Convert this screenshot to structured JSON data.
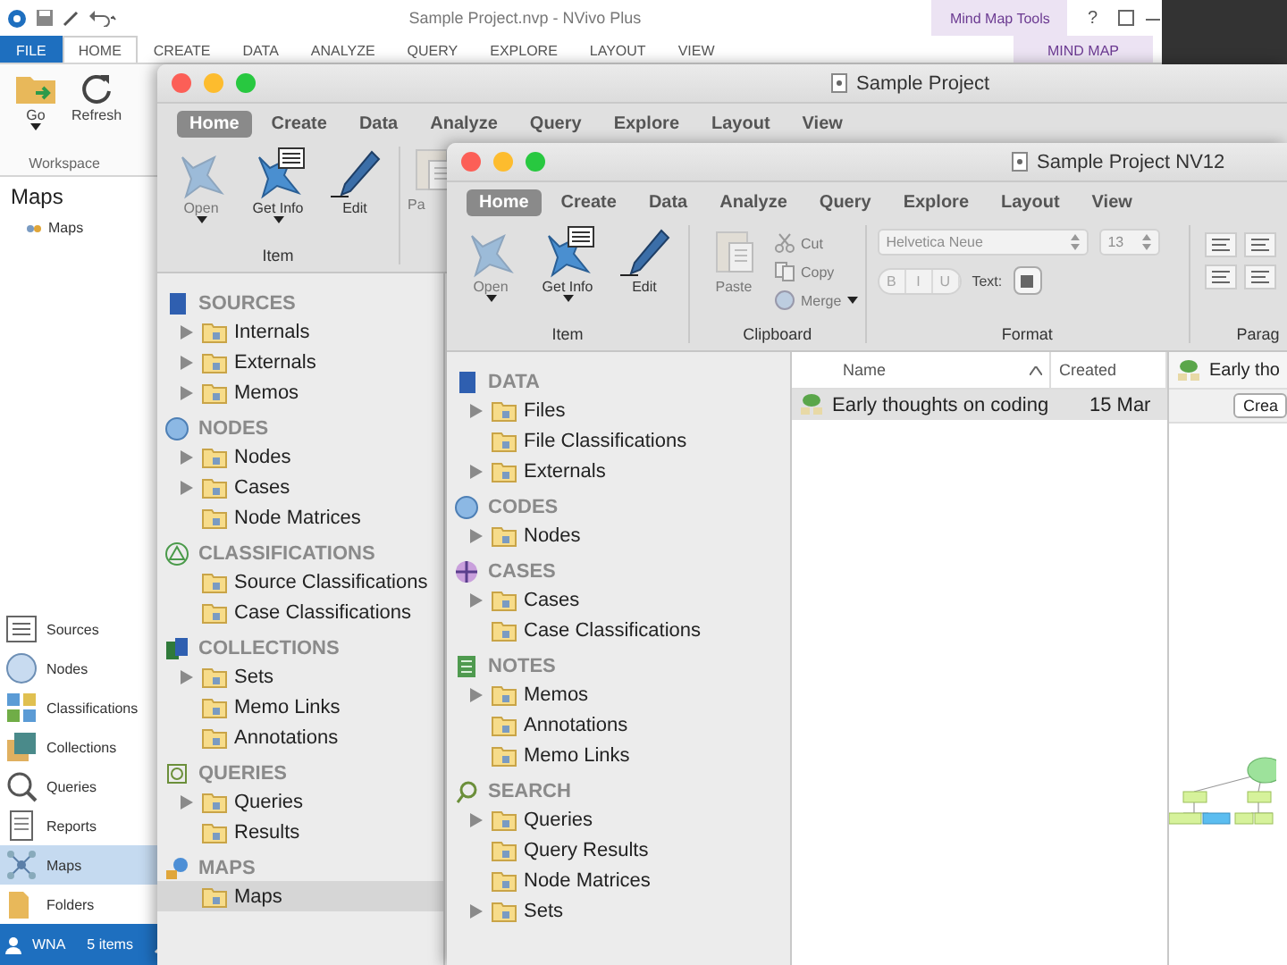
{
  "back_window": {
    "title": "Sample Project.nvp - NVivo Plus",
    "tool_group": "Mind Map Tools",
    "help": "?",
    "tabs": [
      {
        "label": "FILE",
        "kind": "file",
        "selected": false
      },
      {
        "label": "HOME",
        "kind": "main",
        "selected": true
      },
      {
        "label": "CREATE",
        "kind": "main",
        "selected": false
      },
      {
        "label": "DATA",
        "kind": "main",
        "selected": false
      },
      {
        "label": "ANALYZE",
        "kind": "main",
        "selected": false
      },
      {
        "label": "QUERY",
        "kind": "main",
        "selected": false
      },
      {
        "label": "EXPLORE",
        "kind": "main",
        "selected": false
      },
      {
        "label": "LAYOUT",
        "kind": "main",
        "selected": false
      },
      {
        "label": "VIEW",
        "kind": "main",
        "selected": false
      },
      {
        "label": "MIND MAP",
        "kind": "tool",
        "selected": false
      }
    ],
    "ribbon": {
      "group": "Workspace",
      "buttons": [
        {
          "label": "Go",
          "kind": "go",
          "dropdown": true
        },
        {
          "label": "Refresh",
          "kind": "refresh",
          "dropdown": false
        }
      ]
    },
    "navigation_title": "Maps",
    "tree": [
      {
        "label": "Maps",
        "selected": false
      }
    ],
    "nav_buttons": [
      {
        "label": "Sources",
        "kind": "sources",
        "selected": false
      },
      {
        "label": "Nodes",
        "kind": "nodes",
        "selected": false
      },
      {
        "label": "Classifications",
        "kind": "classifications",
        "selected": false
      },
      {
        "label": "Collections",
        "kind": "collections",
        "selected": false
      },
      {
        "label": "Queries",
        "kind": "queries",
        "selected": false
      },
      {
        "label": "Reports",
        "kind": "reports",
        "selected": false
      },
      {
        "label": "Maps",
        "kind": "maps",
        "selected": true
      },
      {
        "label": "Folders",
        "kind": "folders",
        "selected": false
      }
    ],
    "status_bar": {
      "user": "WNA",
      "items": "5 items"
    }
  },
  "middle_window": {
    "title": "Sample Project",
    "tabs": [
      {
        "label": "Home",
        "selected": true
      },
      {
        "label": "Create",
        "selected": false
      },
      {
        "label": "Data",
        "selected": false
      },
      {
        "label": "Analyze",
        "selected": false
      },
      {
        "label": "Query",
        "selected": false
      },
      {
        "label": "Explore",
        "selected": false
      },
      {
        "label": "Layout",
        "selected": false
      },
      {
        "label": "View",
        "selected": false
      }
    ],
    "ribbon": {
      "group": "Item",
      "buttons": [
        {
          "label": "Open",
          "kind": "node",
          "disabled": true,
          "dropdown": true
        },
        {
          "label": "Get Info",
          "kind": "info",
          "disabled": false,
          "dropdown": true
        },
        {
          "label": "Edit",
          "kind": "pencil",
          "disabled": false,
          "dropdown": false
        }
      ],
      "partial_button": {
        "label": "Pa",
        "kind": "paste",
        "disabled": true
      }
    },
    "sidebar": [
      {
        "heading": "SOURCES",
        "kind": "book",
        "items": [
          {
            "label": "Internals",
            "expandable": true,
            "selected": false
          },
          {
            "label": "Externals",
            "expandable": true,
            "selected": false
          },
          {
            "label": "Memos",
            "expandable": true,
            "selected": false
          }
        ]
      },
      {
        "heading": "NODES",
        "kind": "sphere",
        "items": [
          {
            "label": "Nodes",
            "expandable": true,
            "selected": false
          },
          {
            "label": "Cases",
            "expandable": true,
            "selected": false
          },
          {
            "label": "Node Matrices",
            "expandable": false,
            "selected": false
          }
        ]
      },
      {
        "heading": "CLASSIFICATIONS",
        "kind": "triangle",
        "items": [
          {
            "label": "Source Classifications",
            "expandable": false,
            "selected": false
          },
          {
            "label": "Case Classifications",
            "expandable": false,
            "selected": false
          }
        ]
      },
      {
        "heading": "COLLECTIONS",
        "kind": "stack",
        "items": [
          {
            "label": "Sets",
            "expandable": true,
            "selected": false
          },
          {
            "label": "Memo Links",
            "expandable": false,
            "selected": false
          },
          {
            "label": "Annotations",
            "expandable": false,
            "selected": false
          }
        ]
      },
      {
        "heading": "QUERIES",
        "kind": "query",
        "items": [
          {
            "label": "Queries",
            "expandable": true,
            "selected": false
          },
          {
            "label": "Results",
            "expandable": false,
            "selected": false
          }
        ]
      },
      {
        "heading": "MAPS",
        "kind": "map",
        "items": [
          {
            "label": "Maps",
            "expandable": false,
            "selected": true
          }
        ]
      }
    ]
  },
  "front_window": {
    "title": "Sample Project NV12",
    "tabs": [
      {
        "label": "Home",
        "selected": true
      },
      {
        "label": "Create",
        "selected": false
      },
      {
        "label": "Data",
        "selected": false
      },
      {
        "label": "Analyze",
        "selected": false
      },
      {
        "label": "Query",
        "selected": false
      },
      {
        "label": "Explore",
        "selected": false
      },
      {
        "label": "Layout",
        "selected": false
      },
      {
        "label": "View",
        "selected": false
      }
    ],
    "ribbon": [
      {
        "kind": "buttons",
        "label": "Item",
        "buttons": [
          {
            "label": "Open",
            "kind": "node",
            "disabled": true,
            "dropdown": true
          },
          {
            "label": "Get Info",
            "kind": "info",
            "disabled": false,
            "dropdown": true
          },
          {
            "label": "Edit",
            "kind": "pencil",
            "disabled": false,
            "dropdown": false
          }
        ]
      },
      {
        "kind": "clipboard",
        "label": "Clipboard",
        "paste": {
          "label": "Paste",
          "disabled": true
        },
        "small": [
          {
            "label": "Cut",
            "kind": "cut",
            "disabled": true,
            "dropdown": false
          },
          {
            "label": "Copy",
            "kind": "copy",
            "disabled": true,
            "dropdown": false
          },
          {
            "label": "Merge",
            "kind": "merge",
            "disabled": true,
            "dropdown": true
          }
        ]
      },
      {
        "kind": "format",
        "label": "Format",
        "font": "Helvetica Neue",
        "size": "13",
        "styles": [
          "B",
          "I",
          "U"
        ],
        "text_label": "Text:",
        "disabled": true
      },
      {
        "kind": "paragraph",
        "label": "Parag"
      }
    ],
    "sidebar": [
      {
        "heading": "DATA",
        "kind": "book",
        "items": [
          {
            "label": "Files",
            "expandable": true,
            "selected": false
          },
          {
            "label": "File Classifications",
            "expandable": false,
            "selected": false
          },
          {
            "label": "Externals",
            "expandable": true,
            "selected": false
          }
        ]
      },
      {
        "heading": "CODES",
        "kind": "sphere",
        "items": [
          {
            "label": "Nodes",
            "expandable": true,
            "selected": false
          }
        ]
      },
      {
        "heading": "CASES",
        "kind": "disc",
        "items": [
          {
            "label": "Cases",
            "expandable": true,
            "selected": false
          },
          {
            "label": "Case Classifications",
            "expandable": false,
            "selected": false
          }
        ]
      },
      {
        "heading": "NOTES",
        "kind": "notes",
        "items": [
          {
            "label": "Memos",
            "expandable": true,
            "selected": false
          },
          {
            "label": "Annotations",
            "expandable": false,
            "selected": false
          },
          {
            "label": "Memo Links",
            "expandable": false,
            "selected": false
          }
        ]
      },
      {
        "heading": "SEARCH",
        "kind": "search",
        "items": [
          {
            "label": "Queries",
            "expandable": true,
            "selected": false
          },
          {
            "label": "Query Results",
            "expandable": false,
            "selected": false
          },
          {
            "label": "Node Matrices",
            "expandable": false,
            "selected": false
          },
          {
            "label": "Sets",
            "expandable": true,
            "selected": false
          }
        ]
      }
    ],
    "table": {
      "columns": [
        {
          "label": "Name",
          "sorted": true
        },
        {
          "label": "Created",
          "sorted": false
        }
      ],
      "rows": [
        {
          "cells": [
            "Early thoughts on coding",
            "15 Mar"
          ],
          "selected": true
        }
      ]
    },
    "preview": {
      "title": "Early tho",
      "button": "Crea"
    }
  }
}
